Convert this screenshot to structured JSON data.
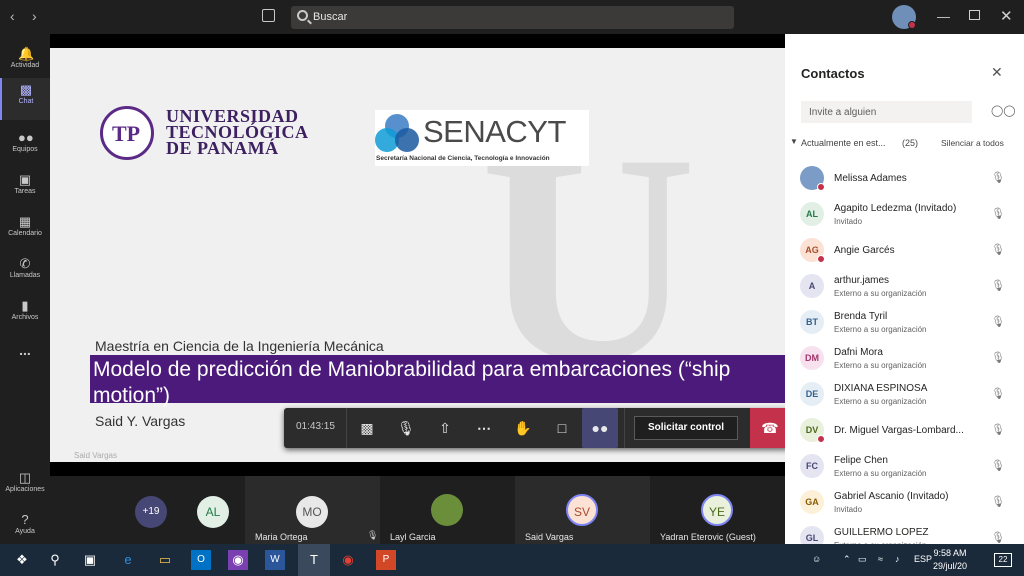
{
  "topbar": {
    "search_placeholder": "Buscar",
    "back_icon": "chevron-left-icon",
    "forward_icon": "chevron-right-icon",
    "compose_icon": "compose-icon",
    "minimize_icon": "minimize-icon",
    "maximize_icon": "maximize-icon",
    "close_icon": "close-icon"
  },
  "rail": {
    "items": [
      {
        "label": "Actividad",
        "icon": "bell-icon"
      },
      {
        "label": "Chat",
        "icon": "chat-icon",
        "active": true
      },
      {
        "label": "Equipos",
        "icon": "teams-icon"
      },
      {
        "label": "Tareas",
        "icon": "assignments-icon"
      },
      {
        "label": "Calendario",
        "icon": "calendar-icon"
      },
      {
        "label": "Llamadas",
        "icon": "phone-icon"
      },
      {
        "label": "Archivos",
        "icon": "files-icon"
      }
    ],
    "more": "...",
    "bottom": [
      {
        "label": "Aplicaciones",
        "icon": "apps-icon"
      },
      {
        "label": "Ayuda",
        "icon": "help-icon"
      }
    ]
  },
  "slide": {
    "univ_line1": "UNIVERSIDAD",
    "univ_line2": "TECNOLÓGICA",
    "univ_line3": "DE PANAMÁ",
    "senacyt": "SENACYT",
    "senacyt_sub": "Secretaría Nacional de Ciencia, Tecnología e Innovación",
    "program": "Maestría en Ciencia de la Ingeniería Mecánica",
    "title": "Modelo de predicción de Maniobrabilidad para embarcaciones (“ship motion”)",
    "author": "Said Y. Vargas",
    "presenter_tag": "Said Vargas"
  },
  "controls": {
    "timer": "01:43:15",
    "request_control": "Solicitar control"
  },
  "tiles": [
    {
      "initials": "+19",
      "name": "",
      "bg": "#464775",
      "fg": "#ffffff"
    },
    {
      "initials": "AL",
      "name": "",
      "bg": "#e1efe4",
      "fg": "#237b4b"
    },
    {
      "initials": "MO",
      "name": "Maria Ortega",
      "bg": "#e8e8e8",
      "fg": "#555555"
    },
    {
      "initials": "",
      "name": "Layl Garcia",
      "bg": "#6b8e3a",
      "fg": "#ffffff"
    },
    {
      "initials": "SV",
      "name": "Said Vargas",
      "bg": "#fbe2d5",
      "fg": "#a94c2a"
    },
    {
      "initials": "YE",
      "name": "Yadran Eterovic (Guest)",
      "bg": "#e9f0dc",
      "fg": "#4d6a1a"
    }
  ],
  "panel": {
    "title": "Contactos",
    "invite_placeholder": "Invite a alguien",
    "section_label": "Actualmente en est...",
    "section_count": "(25)",
    "mute_all": "Silenciar a todos",
    "people": [
      {
        "initials": "",
        "name": "Melissa Adames",
        "sub": "",
        "bg": "#7a9cc6",
        "fg": "#fff",
        "dot": true
      },
      {
        "initials": "AL",
        "name": "Agapito Ledezma (Invitado)",
        "sub": "Invitado",
        "bg": "#e1efe4",
        "fg": "#237b4b",
        "dot": false
      },
      {
        "initials": "AG",
        "name": "Angie Garcés",
        "sub": "",
        "bg": "#fbe2d5",
        "fg": "#a94c2a",
        "dot": true
      },
      {
        "initials": "A",
        "name": "arthur.james",
        "sub": "Externo a su organización",
        "bg": "#e5e5f1",
        "fg": "#464775",
        "dot": false
      },
      {
        "initials": "BT",
        "name": "Brenda Tyril",
        "sub": "Externo a su organización",
        "bg": "#e6eef5",
        "fg": "#33618e",
        "dot": false
      },
      {
        "initials": "DM",
        "name": "Dafni Mora",
        "sub": "Externo a su organización",
        "bg": "#f8e1ee",
        "fg": "#a2366b",
        "dot": false
      },
      {
        "initials": "DE",
        "name": "DIXIANA ESPINOSA",
        "sub": "Externo a su organización",
        "bg": "#e6eef5",
        "fg": "#33618e",
        "dot": false
      },
      {
        "initials": "DV",
        "name": "Dr. Miguel Vargas-Lombard...",
        "sub": "",
        "bg": "#e9f0dc",
        "fg": "#4d6a1a",
        "dot": true
      },
      {
        "initials": "FC",
        "name": "Felipe Chen",
        "sub": "Externo a su organización",
        "bg": "#e5e5f1",
        "fg": "#464775",
        "dot": false
      },
      {
        "initials": "GA",
        "name": "Gabriel Ascanio (Invitado)",
        "sub": "Invitado",
        "bg": "#fdf0d8",
        "fg": "#8a5a00",
        "dot": false
      },
      {
        "initials": "GL",
        "name": "GUILLERMO LOPEZ",
        "sub": "Externo a su organización",
        "bg": "#e5e5f1",
        "fg": "#464775",
        "dot": false
      }
    ]
  },
  "taskbar": {
    "lang": "ESP",
    "time": "9:58 AM",
    "date": "29/jul/20",
    "notifications": "22"
  }
}
